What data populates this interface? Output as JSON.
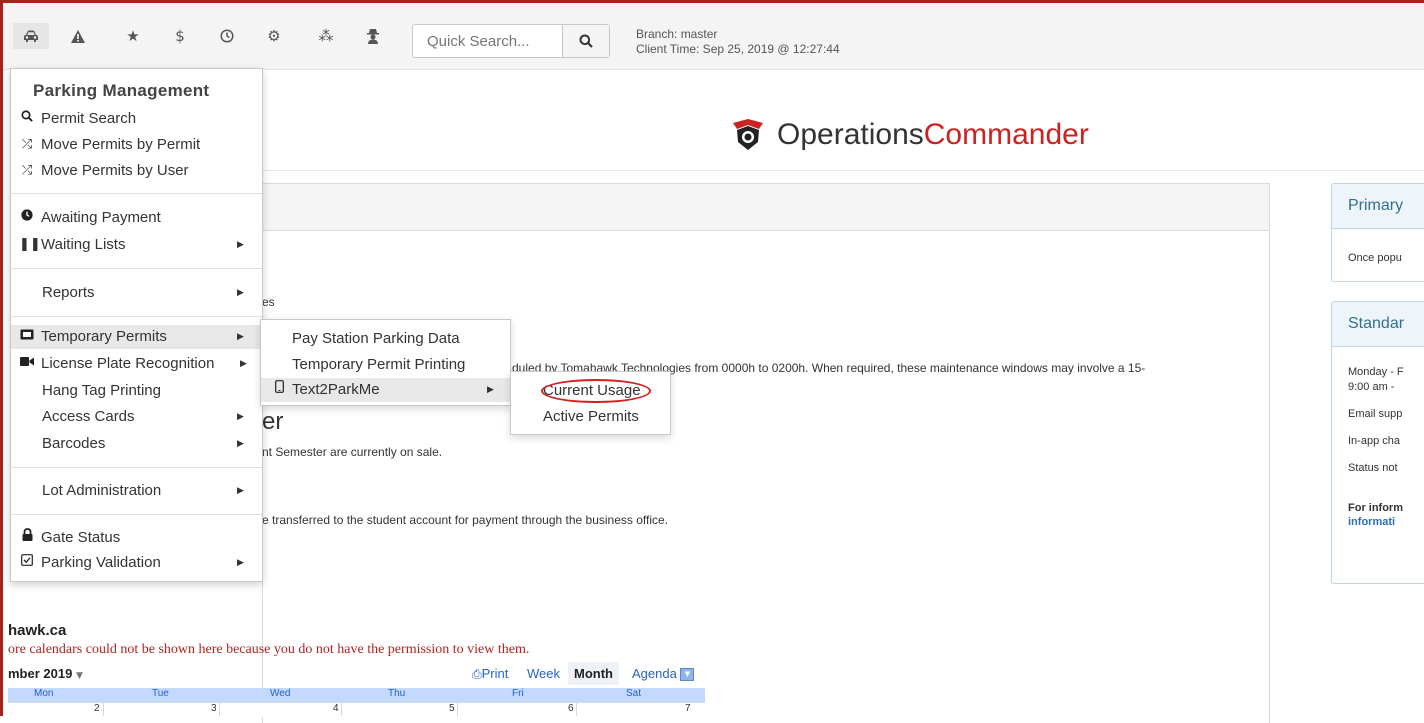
{
  "toolbar": {
    "icons": [
      "car-icon",
      "warning-icon",
      "star-icon",
      "dollar-icon",
      "clock-icon",
      "gears-icon",
      "cubes-icon",
      "user-secret-icon"
    ],
    "search_placeholder": "Quick Search...",
    "branch": "Branch: master",
    "client_time": "Client Time: Sep 25, 2019 @ 12:27:44"
  },
  "logo": {
    "part1": "Operations",
    "part2": "Commander",
    "accent": "#cc2222"
  },
  "menu": {
    "title": "Parking Management",
    "items": [
      {
        "label": "Permit Search",
        "icon": "search-icon"
      },
      {
        "label": "Move Permits by Permit",
        "icon": "shuffle-icon"
      },
      {
        "label": "Move Permits by User",
        "icon": "shuffle-icon"
      },
      {
        "label": "Awaiting Payment",
        "icon": "clock-icon"
      },
      {
        "label": "Waiting Lists",
        "icon": "pause-icon"
      },
      {
        "label": "Reports"
      },
      {
        "label": "Temporary Permits",
        "icon": "ticket-icon"
      },
      {
        "label": "License Plate Recognition",
        "icon": "video-camera-icon"
      },
      {
        "label": "Hang Tag Printing"
      },
      {
        "label": "Access Cards"
      },
      {
        "label": "Barcodes"
      },
      {
        "label": "Lot Administration"
      },
      {
        "label": "Gate Status",
        "icon": "lock-icon"
      },
      {
        "label": "Parking Validation",
        "icon": "checkbox-icon"
      }
    ]
  },
  "submenu1": {
    "items": [
      {
        "label": "Pay Station Parking Data"
      },
      {
        "label": "Temporary Permit Printing"
      },
      {
        "label": "Text2ParkMe",
        "icon": "mobile-icon"
      }
    ]
  },
  "submenu2": {
    "items": [
      {
        "label": "Current Usage"
      },
      {
        "label": "Active Permits"
      }
    ]
  },
  "content": {
    "line1": "es",
    "line2": "duled by Tomahawk Technologies from 0000h to 0200h. When required, these maintenance windows may involve a 15-",
    "heading": "er",
    "line3": "nt Semester are currently on sale.",
    "line4": "e transferred to the student account for payment through the business office."
  },
  "sidebar": {
    "panel1_title": "Primary",
    "panel1_line": "Once popu",
    "panel2_title": "Standar",
    "panel2_lines": [
      "Monday - F",
      "9:00 am -",
      "Email supp",
      "In-app cha",
      "Status not"
    ],
    "info_bold": "For inform",
    "info_link": "informati"
  },
  "calendar": {
    "title": "hawk.ca",
    "warning": "ore calendars could not be shown here because you do not have the permission to view them.",
    "month": "mber 2019",
    "print": "Print",
    "week": "Week",
    "month_tab": "Month",
    "agenda": "Agenda",
    "days": [
      "Mon",
      "Tue",
      "Wed",
      "Thu",
      "Fri",
      "Sat"
    ],
    "nums": [
      "2",
      "3",
      "4",
      "5",
      "6",
      "7"
    ]
  }
}
